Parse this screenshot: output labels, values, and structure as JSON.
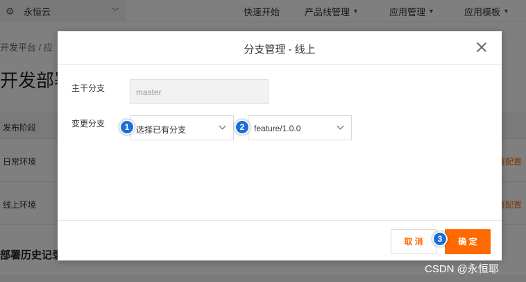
{
  "topbar": {
    "org_name": "永恒云",
    "nav": [
      {
        "label": "快速开始",
        "has_caret": false
      },
      {
        "label": "产品线管理",
        "has_caret": true
      },
      {
        "label": "应用管理",
        "has_caret": true
      },
      {
        "label": "应用模板",
        "has_caret": true
      }
    ]
  },
  "page": {
    "breadcrumb": "开发平台 / 应",
    "title": "开发部署",
    "table_header": "发布阶段",
    "rows": [
      {
        "stage": "日常环境",
        "action": "署配置"
      },
      {
        "stage": "线上环境",
        "action": "署配置"
      }
    ],
    "history_title": "部署历史记录"
  },
  "modal": {
    "title": "分支管理 - 线上",
    "trunk_label": "主干分支",
    "trunk_value": "master",
    "change_label": "变更分支",
    "branch_mode": "选择已有分支",
    "branch_value": "feature/1.0.0",
    "cancel_label": "取 消",
    "ok_label": "确 定"
  },
  "annotations": {
    "step1": "1",
    "step2": "2",
    "step3": "3",
    "color": "#1a6fd6"
  },
  "watermark": "CSDN @永恒耶",
  "colors": {
    "accent": "#ff6a00",
    "overlay": "rgba(0,0,0,0.5)"
  }
}
